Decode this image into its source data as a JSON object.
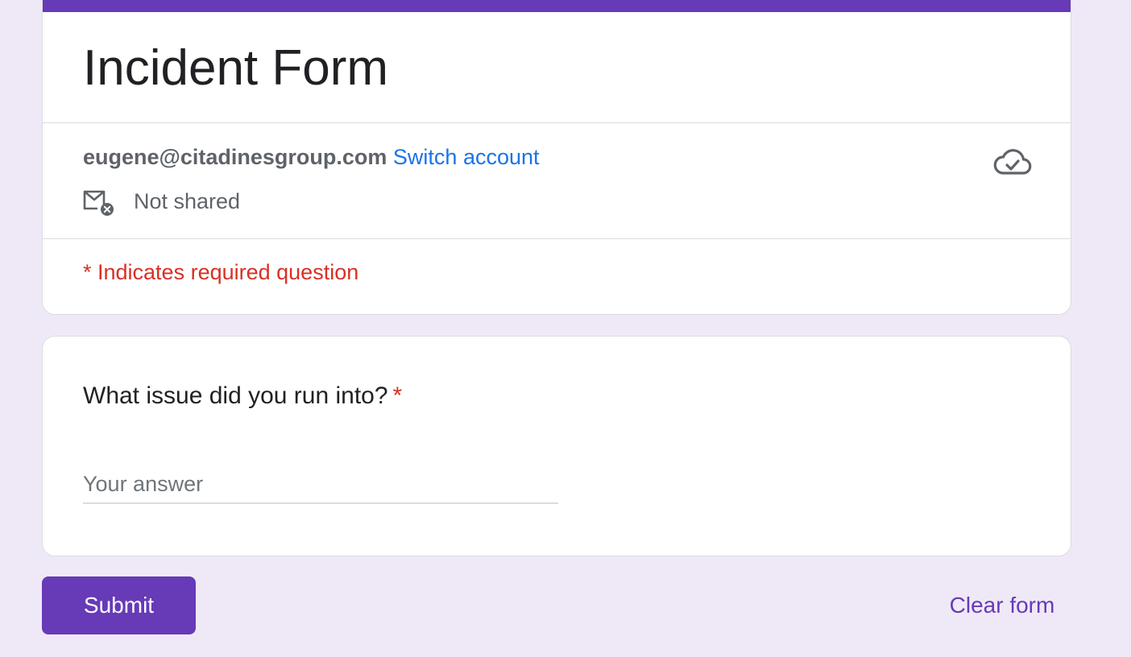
{
  "form": {
    "title": "Incident Form",
    "accent_color": "#673ab7"
  },
  "account": {
    "email": "eugene@citadinesgroup.com",
    "switch_label": "Switch account",
    "share_status": "Not shared",
    "share_icon": "mail-not-shared-icon",
    "saved_icon": "cloud-done-icon"
  },
  "required_note": "* Indicates required question",
  "question": {
    "text": "What issue did you run into?",
    "required_marker": "*",
    "placeholder": "Your answer",
    "value": ""
  },
  "actions": {
    "submit_label": "Submit",
    "clear_label": "Clear form"
  }
}
